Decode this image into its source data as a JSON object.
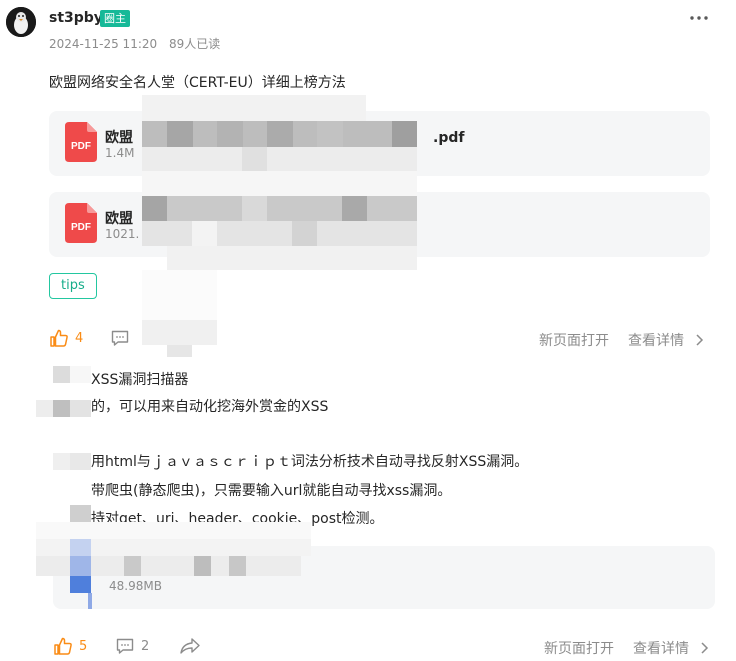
{
  "post1": {
    "username": "st3pby",
    "badge": "圈主",
    "date": "2024-11-25 11:20",
    "reads": "89人已读",
    "title": "欧盟网络安全名人堂（CERT-EU）详细上榜方法",
    "files": [
      {
        "type": "PDF",
        "name_start": "欧盟",
        "name_end": ".pdf",
        "size": "1.4M"
      },
      {
        "type": "PDF",
        "name_start": "欧盟",
        "name_end": "",
        "size": "1021."
      }
    ],
    "tag": "tips",
    "likes": "4",
    "actions": {
      "open_new": "新页面打开",
      "view_detail": "查看详情"
    }
  },
  "post2": {
    "lines": [
      "XSS漏洞扫描器",
      "的，可以用来自动化挖海外赏金的XSS",
      "",
      "用html与ｊａｖａｓｃｒｉｐｔ词法分析技术自动寻找反射XSS漏洞。",
      "带爬虫(静态爬虫)，只需要输入url就能自动寻找xss漏洞。",
      "持对get、uri、header、cookie、post检测。"
    ],
    "file": {
      "size": "48.98MB"
    },
    "likes": "5",
    "comments": "2",
    "actions": {
      "open_new": "新页面打开",
      "view_detail": "查看详情"
    }
  },
  "colors": {
    "accent_green": "#16b998",
    "like_orange": "#fa8c16",
    "pdf_red": "#ef4a4a",
    "muted_text": "#8c8c8c"
  },
  "icons": [
    "pdf-icon",
    "like-icon",
    "comment-icon",
    "share-icon",
    "chevron-right-icon",
    "more-icon"
  ]
}
